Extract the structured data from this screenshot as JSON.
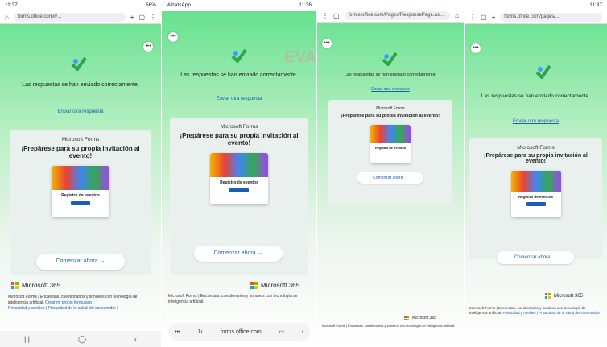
{
  "colors": {
    "accent": "#1a5fb4",
    "gradient_top": "#5fe08a"
  },
  "form": {
    "confirmation": "Las respuestas se han enviado correctamente.",
    "another_link": "Enviar otra respuesta",
    "brand": "Microsoft Forms",
    "headline": "¡Prepárese para su propia invitación al evento!",
    "invite_title": "Registro de eventos",
    "cta": "Comenzar ahora →",
    "ms365": "Microsoft 365",
    "footer_p1": "Microsoft Forms | Encuestas, cuestionarios y sondeos con tecnología de inteligencia artificial.",
    "footer_link1": "Crear mi propio formulario",
    "footer_p2": "Privacidad y cookies | Privacidad de la salud del consumidor |"
  },
  "p1": {
    "time": "11:37",
    "status_right": "56%",
    "url": "forms.office.com/r/...",
    "nav": [
      "|||",
      "◯",
      "‹"
    ]
  },
  "p2": {
    "time": "11:36",
    "status_right": "WhatsApp",
    "url": "forms.office.com"
  },
  "p3": {
    "url": "forms.office.com/Pages/ResponsePage.aspx?id=..."
  },
  "p4": {
    "time": "11:37",
    "url": "forms.office.com/pages/..."
  },
  "icons": [
    "home-icon",
    "lock-icon",
    "plus-icon",
    "tabs-icon",
    "more-icon",
    "check-icon",
    "refresh-icon",
    "bookmark-icon",
    "forward-icon",
    "microsoft-logo-icon"
  ]
}
